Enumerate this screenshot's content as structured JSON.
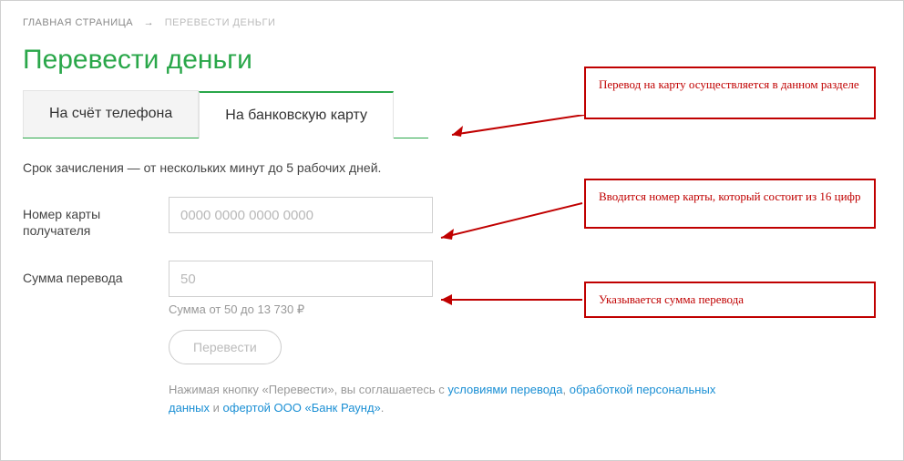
{
  "breadcrumb": {
    "home": "ГЛАВНАЯ СТРАНИЦА",
    "arrow": "→",
    "current": "ПЕРЕВЕСТИ ДЕНЬГИ"
  },
  "title": "Перевести деньги",
  "tabs": {
    "phone": "На счёт телефона",
    "card": "На банковскую карту"
  },
  "info": "Срок зачисления — от нескольких минут до 5 рабочих дней.",
  "form": {
    "card_label": "Номер карты получателя",
    "card_placeholder": "0000 0000 0000 0000",
    "amount_label": "Сумма перевода",
    "amount_placeholder": "50",
    "amount_hint": "Сумма от 50 до 13 730 ₽",
    "submit": "Перевести"
  },
  "disclaimer": {
    "prefix": "Нажимая кнопку «Перевести», вы соглашаетесь с ",
    "link1": "условиями перевода",
    "sep1": ", ",
    "link2": "обработкой персональных данных",
    "sep2": " и ",
    "link3": "офертой ООО «Банк Раунд»",
    "suffix": "."
  },
  "annotations": {
    "a1": "Перевод на карту осуществляется в данном разделе",
    "a2": "Вводится номер карты, который состоит из 16 цифр",
    "a3": "Указывается сумма перевода"
  }
}
